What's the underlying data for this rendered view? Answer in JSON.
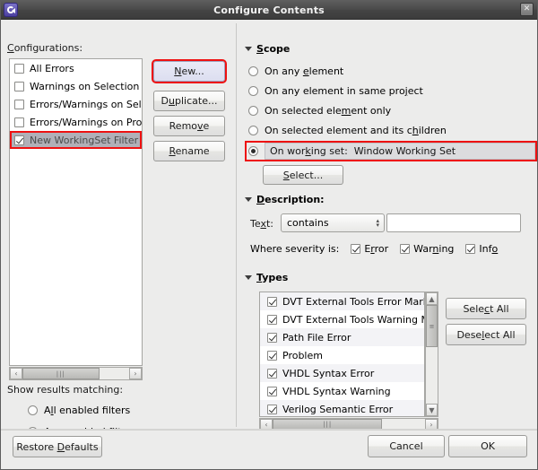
{
  "window": {
    "title": "Configure Contents",
    "icon": "eclipse-app-icon",
    "close_label": "✕"
  },
  "left": {
    "configurations_label": "Configurations:",
    "configurations": [
      {
        "label": "All Errors",
        "checked": false,
        "selected": false
      },
      {
        "label": "Warnings on Selection",
        "checked": false,
        "selected": false
      },
      {
        "label": "Errors/Warnings on Sele",
        "checked": false,
        "selected": false
      },
      {
        "label": "Errors/Warnings on Proj",
        "checked": false,
        "selected": false
      },
      {
        "label": "New WorkingSet Filter",
        "checked": true,
        "selected": true
      }
    ],
    "buttons": [
      {
        "label": "New...",
        "highlighted": true
      },
      {
        "label": "Duplicate...",
        "highlighted": false
      },
      {
        "label": "Remove",
        "highlighted": false
      },
      {
        "label": "Rename",
        "highlighted": false
      }
    ],
    "show_results_label": "Show results matching:",
    "match_options": [
      {
        "label": "All enabled filters",
        "selected": false
      },
      {
        "label": "Any enabled filter",
        "selected": true
      }
    ],
    "restore_defaults_label": "Restore Defaults"
  },
  "right": {
    "scope": {
      "title": "Scope",
      "options": [
        {
          "label": "On any element",
          "selected": false
        },
        {
          "label": "On any element in same project",
          "selected": false
        },
        {
          "label": "On selected element only",
          "selected": false
        },
        {
          "label": "On selected element and its children",
          "selected": false
        }
      ],
      "working_set": {
        "label": "On working set:  Window Working Set",
        "selected": true,
        "highlighted": true
      },
      "select_button": "Select..."
    },
    "description": {
      "title": "Description:",
      "text_label": "Text:",
      "operator_value": "contains",
      "text_value": "",
      "severity_label": "Where severity is:",
      "severities": [
        {
          "label": "Error",
          "checked": true
        },
        {
          "label": "Warning",
          "checked": true
        },
        {
          "label": "Info",
          "checked": true
        }
      ]
    },
    "types": {
      "title": "Types",
      "items": [
        {
          "label": "DVT External Tools Error Mark",
          "checked": true
        },
        {
          "label": "DVT External Tools Warning M",
          "checked": true
        },
        {
          "label": "Path File Error",
          "checked": true
        },
        {
          "label": "Problem",
          "checked": true
        },
        {
          "label": "VHDL Syntax Error",
          "checked": true
        },
        {
          "label": "VHDL Syntax Warning",
          "checked": true
        },
        {
          "label": "Verilog Semantic Error",
          "checked": true
        }
      ],
      "select_all_label": "Select All",
      "deselect_all_label": "Deselect All"
    }
  },
  "footer": {
    "cancel_label": "Cancel",
    "ok_label": "OK"
  },
  "colors": {
    "highlight_red": "#ee1111",
    "selection_gray": "#b0b0b8",
    "titlebar": "#4a4a4a",
    "dialog_bg": "#ececeb"
  }
}
